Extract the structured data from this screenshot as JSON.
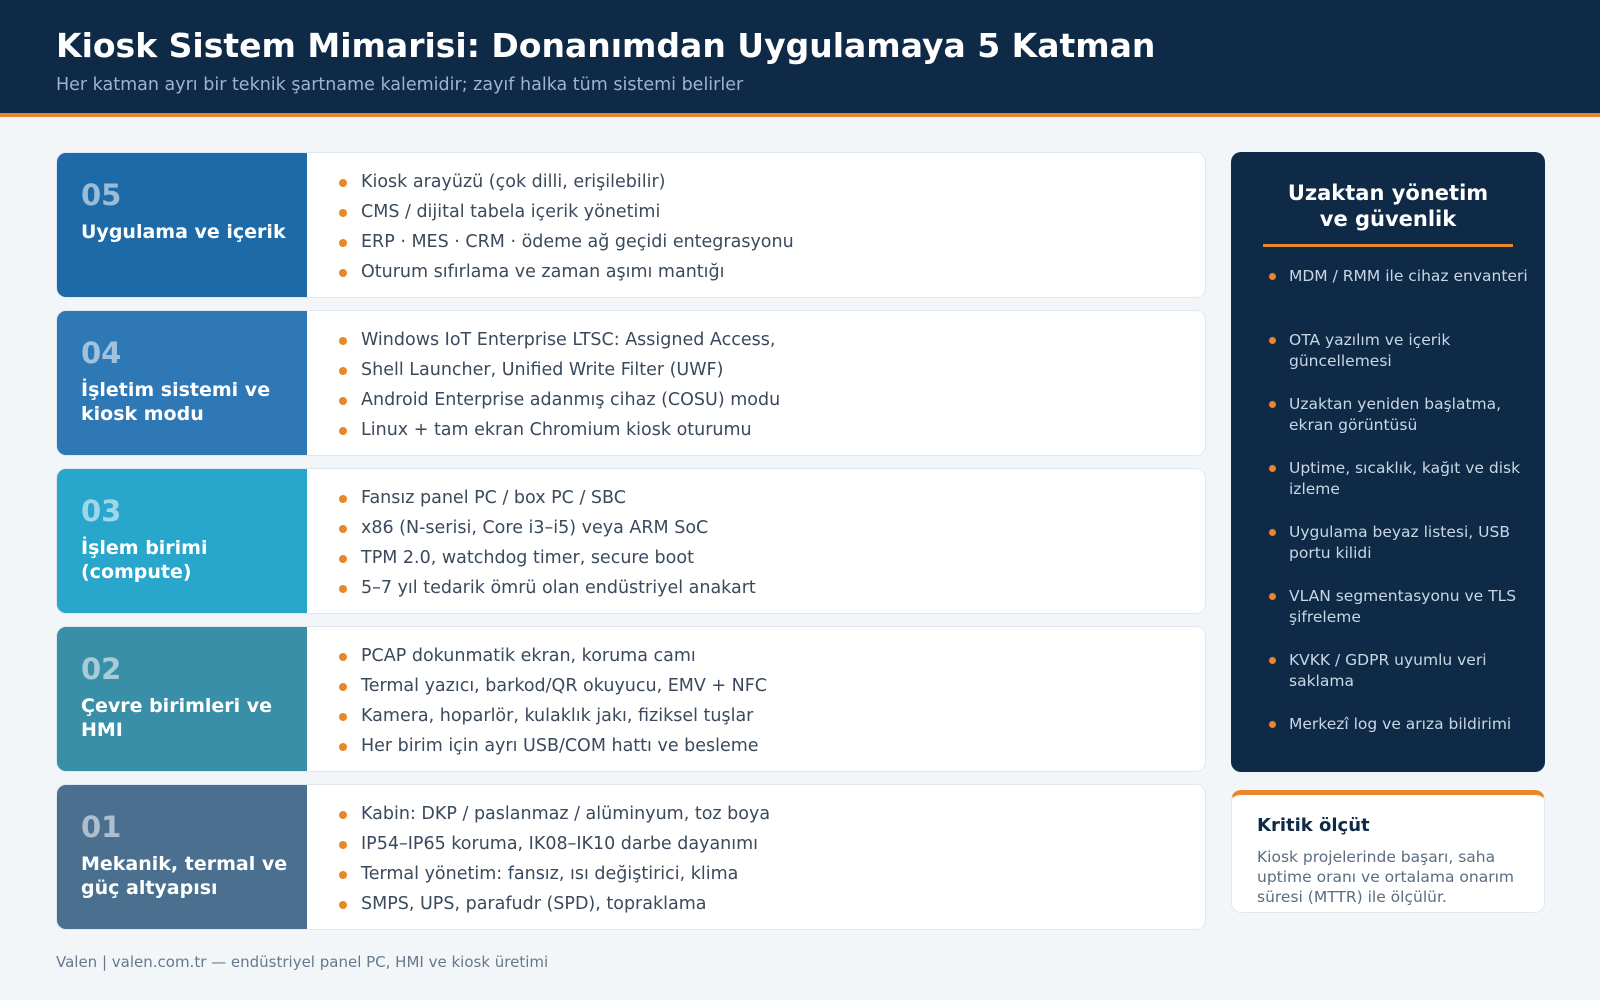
{
  "header": {
    "title": "Kiosk Sistem Mimarisi: Donanımdan Uygulamaya 5 Katman",
    "subtitle": "Her katman ayrı bir teknik şartname kalemidir; zayıf halka tüm sistemi belirler"
  },
  "layers": [
    {
      "num": "05",
      "name": "Uygulama ve içerik",
      "color": "#1e6aa8",
      "items": [
        "Kiosk arayüzü (çok dilli, erişilebilir)",
        "CMS / dijital tabela içerik yönetimi",
        "ERP · MES · CRM · ödeme ağ geçidi entegrasyonu",
        "Oturum sıfırlama ve zaman aşımı mantığı"
      ]
    },
    {
      "num": "04",
      "name": "İşletim sistemi ve kiosk modu",
      "color": "#2e79b5",
      "items": [
        "Windows IoT Enterprise LTSC: Assigned Access,",
        "Shell Launcher, Unified Write Filter (UWF)",
        "Android Enterprise adanmış cihaz (COSU) modu",
        "Linux + tam ekran Chromium kiosk oturumu"
      ]
    },
    {
      "num": "03",
      "name": "İşlem birimi (compute)",
      "color": "#29a6cb",
      "items": [
        "Fansız panel PC / box PC / SBC",
        "x86 (N-serisi, Core i3–i5) veya ARM SoC",
        "TPM 2.0, watchdog timer, secure boot",
        "5–7 yıl tedarik ömrü olan endüstriyel anakart"
      ]
    },
    {
      "num": "02",
      "name": "Çevre birimleri ve HMI",
      "color": "#3a8fa8",
      "items": [
        "PCAP dokunmatik ekran, koruma camı",
        "Termal yazıcı, barkod/QR okuyucu, EMV + NFC",
        "Kamera, hoparlör, kulaklık jakı, fiziksel tuşlar",
        "Her birim için ayrı USB/COM hattı ve besleme"
      ]
    },
    {
      "num": "01",
      "name": "Mekanik, termal ve güç altyapısı",
      "color": "#4b708f",
      "items": [
        "Kabin: DKP / paslanmaz / alüminyum, toz boya",
        "IP54–IP65 koruma, IK08–IK10 darbe dayanımı",
        "Termal yönetim: fansız, ısı değiştirici, klima",
        "SMPS, UPS, parafudr (SPD), topraklama"
      ]
    }
  ],
  "side": {
    "title_line1": "Uzaktan yönetim",
    "title_line2": "ve güvenlik",
    "items": [
      "MDM / RMM ile cihaz envanteri",
      "OTA yazılım ve içerik güncellemesi",
      "Uzaktan yeniden başlatma, ekran görüntüsü",
      "Uptime, sıcaklık, kağıt ve disk izleme",
      "Uygulama beyaz listesi, USB portu kilidi",
      "VLAN segmentasyonu ve TLS şifreleme",
      "KVKK / GDPR uyumlu veri saklama",
      "Merkezî log ve arıza bildirimi"
    ]
  },
  "critical": {
    "title": "Kritik ölçüt",
    "text": "Kiosk projelerinde başarı, saha uptime oranı ve ortalama onarım süresi (MTTR) ile ölçülür."
  },
  "footer": "Valen | valen.com.tr — endüstriyel panel PC, HMI ve kiosk üretimi",
  "colors": {
    "navy": "#0f2a47",
    "accent": "#e8862a"
  }
}
